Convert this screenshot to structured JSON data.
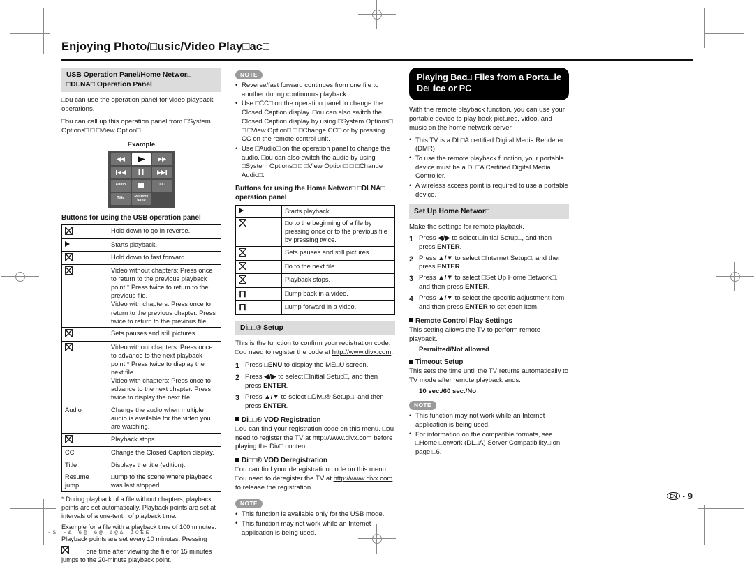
{
  "document": {
    "page_title": "Enjoying Photo/□usic/Video Play□ac□",
    "folio_locale": "EN",
    "folio_dash": "-",
    "folio_page": "9",
    "print_marks": "-$  -&  6@  6@  6@& JOEE"
  },
  "col1": {
    "banner": "USB Operation Panel/Home Networ□ □DLNA□ Operation Panel",
    "intro1": "□ou can use the operation panel for video playback operations.",
    "intro2": "□ou can call up this operation panel from □System Options□ □ □View Option□.",
    "example_label": "Example",
    "remote_keys": [
      {
        "name": "rewind-button",
        "icon": "rewind-icon",
        "label": ""
      },
      {
        "name": "play-button",
        "icon": "play-icon",
        "label": "",
        "highlighted": true
      },
      {
        "name": "fast-forward-button",
        "icon": "fast-forward-icon",
        "label": ""
      },
      {
        "name": "previous-button",
        "icon": "skip-back-icon",
        "label": ""
      },
      {
        "name": "pause-button",
        "icon": "pause-icon",
        "label": ""
      },
      {
        "name": "next-button",
        "icon": "skip-forward-icon",
        "label": ""
      },
      {
        "name": "audio-button",
        "icon": "",
        "label": "Audio"
      },
      {
        "name": "stop-button",
        "icon": "stop-icon",
        "label": ""
      },
      {
        "name": "cc-button",
        "icon": "",
        "label": "CC"
      },
      {
        "name": "title-button",
        "icon": "",
        "label": "Title"
      },
      {
        "name": "resume-jump-button",
        "icon": "",
        "label": "Resume jump"
      },
      {
        "name": "blank-key",
        "icon": "",
        "label": "",
        "blank": true
      }
    ],
    "table_heading": "Buttons for using the USB operation panel",
    "table_rows": [
      {
        "key_glyph": "box",
        "key": "",
        "desc": "Hold down to go in reverse."
      },
      {
        "key_glyph": "play",
        "key": "",
        "desc": "Starts playback."
      },
      {
        "key_glyph": "box",
        "key": "",
        "desc": "Hold down to fast forward."
      },
      {
        "key_glyph": "box",
        "key": "",
        "desc": "Video without chapters: Press once to return to the previous playback point.* Press twice to return to the previous file.\nVideo with chapters: Press once to return to the previous chapter. Press twice to return to the previous file."
      },
      {
        "key_glyph": "box",
        "key": "",
        "desc": "Sets pauses and still pictures."
      },
      {
        "key_glyph": "box",
        "key": "",
        "desc": "Video without chapters: Press once to advance to the next playback point.* Press twice to display the next file.\nVideo with chapters: Press once to advance to the next chapter. Press twice to display the next file."
      },
      {
        "key_glyph": "text",
        "key": "Audio",
        "desc": "Change the audio when multiple audio is available for the video you are watching."
      },
      {
        "key_glyph": "box",
        "key": "",
        "desc": "Playback stops."
      },
      {
        "key_glyph": "text",
        "key": "CC",
        "desc": "Change the Closed Caption display."
      },
      {
        "key_glyph": "text",
        "key": "Title",
        "desc": "Displays the title (edition)."
      },
      {
        "key_glyph": "text",
        "key": "Resume jump",
        "desc": "□ump to the scene where playback was last stopped."
      }
    ],
    "footnote_star": "* During playback of a file without chapters, playback points are set automatically. Playback points are set at intervals of a one-tenth of playback time.",
    "footnote_example_1": "Example for a file with a playback time of 100 minutes:",
    "footnote_example_2": "Playback points are set every 10 minutes. Pressing",
    "footnote_example_3": "one time after viewing the file for 15 minutes jumps to the 20-minute playback point."
  },
  "col2": {
    "note_badge": "NOTE",
    "notes": [
      "Reverse/fast forward continues from one file to another during continuous playback.",
      "Use □CC□ on the operation panel to change the Closed Caption display. □ou can also switch the Closed Caption display by using □System Options□ □ □View Option□ □ □Change CC□ or by pressing CC on the remote control unit.",
      "Use □Audio□ on the operation panel to change the audio. □ou can also switch the audio by using □System Options□ □ □View Option□ □ □Change Audio□."
    ],
    "table_heading": "Buttons for using the Home Networ□ □DLNA□ operation panel",
    "table_rows": [
      {
        "key_glyph": "play",
        "desc": "Starts playback."
      },
      {
        "key_glyph": "box",
        "desc": "□o to the beginning of a file by pressing once or to the previous file by pressing twice."
      },
      {
        "key_glyph": "box",
        "desc": "Sets pauses and still pictures."
      },
      {
        "key_glyph": "box",
        "desc": "□o to the next file."
      },
      {
        "key_glyph": "box",
        "desc": "Playback stops."
      },
      {
        "key_glyph": "arc-left",
        "desc": "□ump back in a video."
      },
      {
        "key_glyph": "arc-right",
        "desc": "□ump forward in a video."
      }
    ],
    "divx_banner": "Di□□® Setup",
    "divx_intro_a": "This is the function to confirm your registration code. □ou need to register the code at ",
    "divx_intro_link": "http://www.divx.com",
    "divx_intro_b": ".",
    "steps": [
      {
        "n": "1",
        "pre": "Press ",
        "b1": "□ENU",
        "mid": " to display the ME□U screen.",
        "b2": "",
        "post": ""
      },
      {
        "n": "2",
        "pre": "Press ",
        "b1": "◀/▶",
        "mid": " to select □Initial Setup□, and then press ",
        "b2": "ENTER",
        "post": "."
      },
      {
        "n": "3",
        "pre": "Press ",
        "b1": "▲/▼",
        "mid": " to select □Div□® Setup□, and then press ",
        "b2": "ENTER",
        "post": "."
      }
    ],
    "vod_reg_head": "Di□□® VOD Registration",
    "vod_reg_a": "□ou can find your registration code on this menu. □ou need to register the TV at ",
    "vod_reg_link": "http://www.divx.com",
    "vod_reg_b": " before playing the Div□ content.",
    "vod_dereg_head": "Di□□® VOD Deregistration",
    "vod_dereg_a": "□ou can find your deregistration code on this menu. □ou need to deregister the TV at ",
    "vod_dereg_link": "http://www.divx.com",
    "vod_dereg_b": " to release the registration.",
    "note_badge2": "NOTE",
    "notes2": [
      "This function is available only for the USB mode.",
      "This function may not work while an Internet application is being used."
    ]
  },
  "col3": {
    "banner": "Playing Bac□ Files from a Porta□le De□ice or PC",
    "intro": "With the remote playback function, you can use your portable device to play back pictures, video, and music on the home network server.",
    "bullets": [
      "This TV is a DL□A certified Digital Media Renderer. (DMR)",
      "To use the remote playback function, your portable device must be a DL□A Certified Digital Media Controller.",
      "A wireless access point is required to use a portable device."
    ],
    "setup_banner": "Set Up Home Networ□",
    "setup_intro": "Make the settings for remote playback.",
    "steps": [
      {
        "n": "1",
        "pre": "Press ",
        "b1": "◀/▶",
        "mid": " to select □Initial Setup□, and then press ",
        "b2": "ENTER",
        "post": "."
      },
      {
        "n": "2",
        "pre": "Press ",
        "b1": "▲/▼",
        "mid": " to select □Internet Setup□, and then press ",
        "b2": "ENTER",
        "post": "."
      },
      {
        "n": "3",
        "pre": "Press ",
        "b1": "▲/▼",
        "mid": " to select □Set Up Home □etwork□, and then press ",
        "b2": "ENTER",
        "post": "."
      },
      {
        "n": "4",
        "pre": "Press ",
        "b1": "▲/▼",
        "mid": " to select the specific adjustment item, and then press ",
        "b2": "ENTER",
        "post": " to set each item."
      }
    ],
    "rc_head": "Remote Control Play Settings",
    "rc_text": "This setting allows the TV to perform remote playback.",
    "rc_options": "Permitted/Not allowed",
    "timeout_head": "Timeout Setup",
    "timeout_text": "This sets the time until the TV returns automatically to TV mode after remote playback ends.",
    "timeout_options": "10 sec./60 sec./No",
    "note_badge": "NOTE",
    "notes": [
      "This function may not work while an Internet application is being used.",
      "For information on the compatible formats, see □Home □etwork (DL□A) Server Compatibility□ on page □6."
    ]
  }
}
